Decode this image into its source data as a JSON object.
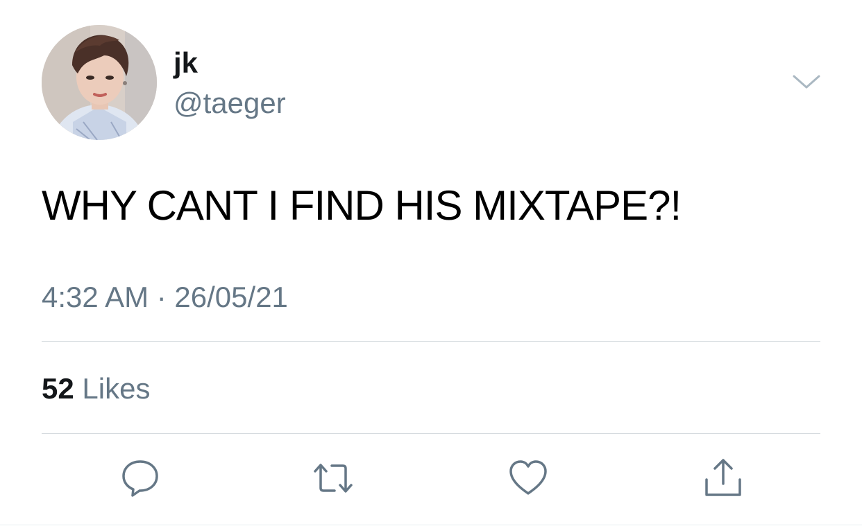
{
  "user": {
    "display_name": "jk",
    "handle": "@taeger",
    "avatar_icon": "profile-photo"
  },
  "tweet": {
    "text": "WHY CANT I FIND HIS MIXTAPE?!",
    "timestamp": "4:32 AM · 26/05/21"
  },
  "stats": {
    "likes_count": "52",
    "likes_label": "Likes"
  },
  "actions": [
    {
      "name": "reply",
      "icon": "speech-bubble-icon"
    },
    {
      "name": "retweet",
      "icon": "retweet-arrows-icon"
    },
    {
      "name": "like",
      "icon": "heart-icon"
    },
    {
      "name": "share",
      "icon": "share-upload-icon"
    }
  ],
  "colors": {
    "primary_text": "#14171a",
    "secondary_text": "#657786",
    "icon": "#657786",
    "divider": "#d6dbdf",
    "background": "#ffffff"
  }
}
